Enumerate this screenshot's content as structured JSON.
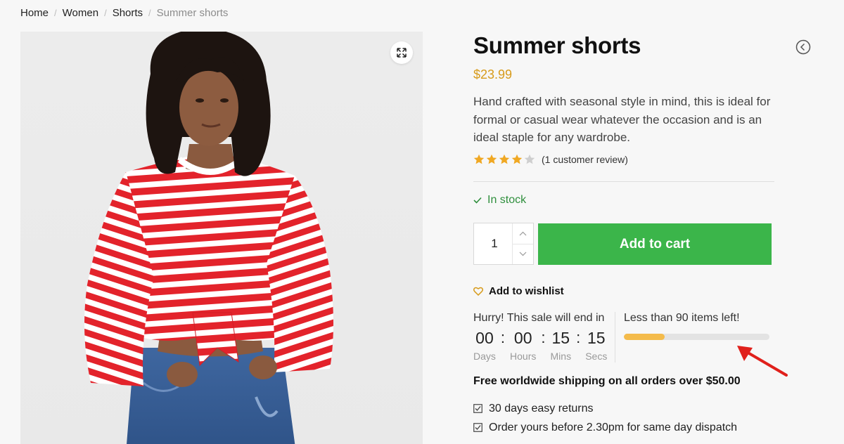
{
  "breadcrumb": {
    "items": [
      "Home",
      "Women",
      "Shorts"
    ],
    "current": "Summer shorts"
  },
  "product": {
    "title": "Summer shorts",
    "price": "$23.99",
    "description": "Hand crafted with seasonal style in mind, this is ideal for formal or casual wear whatever the occasion and is an ideal staple for any wardrobe.",
    "rating": 4,
    "rating_max": 5,
    "review_text": "(1 customer review)",
    "stock_status": "In stock",
    "quantity": "1",
    "add_to_cart_label": "Add to cart",
    "wishlist_label": "Add to wishlist"
  },
  "countdown": {
    "label": "Hurry! This sale will end in",
    "days": "00",
    "hours": "00",
    "mins": "15",
    "secs": "15",
    "days_label": "Days",
    "hours_label": "Hours",
    "mins_label": "Mins",
    "secs_label": "Secs"
  },
  "stock_meter": {
    "label": "Less than 90 items left!",
    "fill_fraction": 0.28
  },
  "shipping": {
    "headline": "Free worldwide shipping on all orders over $50.00",
    "perks": [
      "30 days easy returns",
      "Order yours before 2.30pm for same day dispatch"
    ]
  },
  "colors": {
    "accent_price": "#d79b1b",
    "add_to_cart_bg": "#3bb54a",
    "stock_green": "#2f8f3d",
    "star": "#f0a823",
    "meter_fill": "#f4bb4b",
    "annotation_arrow": "#e0201b"
  },
  "icons": [
    "expand-icon",
    "prev-product-icon",
    "star-icon",
    "check-icon",
    "chevron-up-icon",
    "chevron-down-icon",
    "heart-icon",
    "checkbox-icon",
    "annotation-arrow"
  ]
}
